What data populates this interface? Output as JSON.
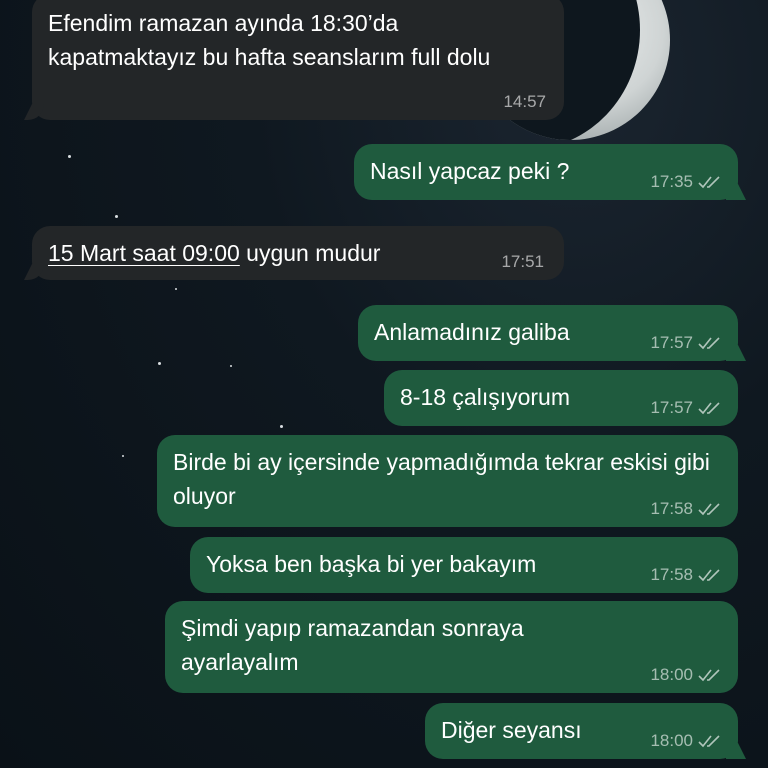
{
  "chat": {
    "messages": [
      {
        "direction": "in",
        "text": "Efendim ramazan ayında 18:30’da kapatmaktayız bu hafta seanslarım full dolu",
        "time": "14:57"
      },
      {
        "direction": "out",
        "text": "Nasıl yapcaz peki ?",
        "time": "17:35"
      },
      {
        "direction": "in",
        "text_link": "15 Mart saat 09:00",
        "text_rest": " uygun mudur",
        "time": "17:51"
      },
      {
        "direction": "out",
        "text": "Anlamadınız galiba",
        "time": "17:57"
      },
      {
        "direction": "out",
        "text": "8-18 çalışıyorum",
        "time": "17:57"
      },
      {
        "direction": "out",
        "text": "Birde bi ay içersinde yapmadığımda tekrar eskisi gibi oluyor",
        "time": "17:58"
      },
      {
        "direction": "out",
        "text": "Yoksa ben başka bi yer bakayım",
        "time": "17:58"
      },
      {
        "direction": "out",
        "text": "Şimdi yapıp ramazandan sonraya ayarlayalım",
        "time": "18:00"
      },
      {
        "direction": "out",
        "text": "Diğer seyansı",
        "time": "18:00"
      }
    ]
  },
  "colors": {
    "incoming_bubble": "#232628",
    "outgoing_bubble": "#1f5b3e",
    "background": "#0a1117"
  },
  "icons": {
    "read_receipt": "double-check-icon"
  }
}
